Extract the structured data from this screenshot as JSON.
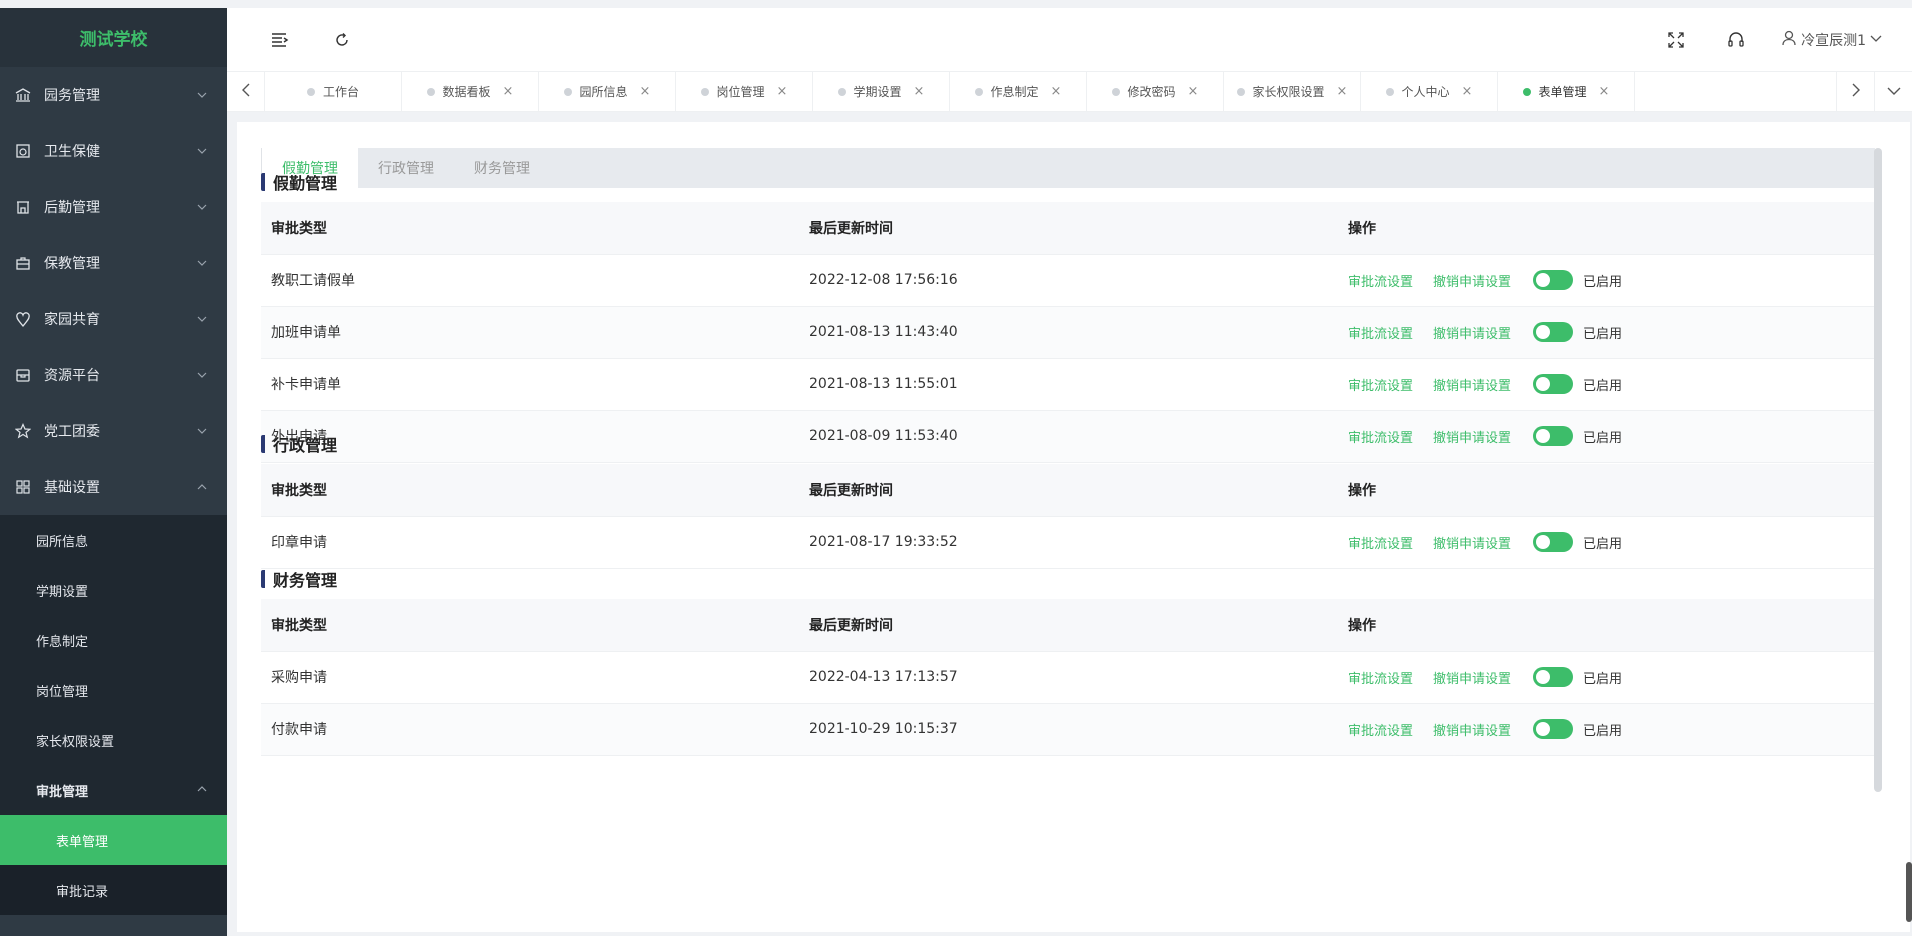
{
  "brand": "测试学校",
  "sidebar": {
    "items": [
      {
        "label": "园务管理"
      },
      {
        "label": "卫生保健"
      },
      {
        "label": "后勤管理"
      },
      {
        "label": "保教管理"
      },
      {
        "label": "家园共育"
      },
      {
        "label": "资源平台"
      },
      {
        "label": "党工团委"
      },
      {
        "label": "基础设置"
      }
    ],
    "sub_items": [
      {
        "label": "园所信息"
      },
      {
        "label": "学期设置"
      },
      {
        "label": "作息制定"
      },
      {
        "label": "岗位管理"
      },
      {
        "label": "家长权限设置"
      },
      {
        "label": "审批管理"
      }
    ],
    "sub_sub_items": [
      {
        "label": "表单管理"
      },
      {
        "label": "审批记录"
      }
    ]
  },
  "header": {
    "user": "冷宣辰测1"
  },
  "tabs": [
    {
      "label": "工作台",
      "closable": false
    },
    {
      "label": "数据看板",
      "closable": true
    },
    {
      "label": "园所信息",
      "closable": true
    },
    {
      "label": "岗位管理",
      "closable": true
    },
    {
      "label": "学期设置",
      "closable": true
    },
    {
      "label": "作息制定",
      "closable": true
    },
    {
      "label": "修改密码",
      "closable": true
    },
    {
      "label": "家长权限设置",
      "closable": true
    },
    {
      "label": "个人中心",
      "closable": true
    },
    {
      "label": "表单管理",
      "closable": true,
      "active": true
    }
  ],
  "close_glyph": "×",
  "subtabs": [
    {
      "label": "假勤管理"
    },
    {
      "label": "行政管理"
    },
    {
      "label": "财务管理"
    }
  ],
  "table_headers": {
    "type": "审批类型",
    "time": "最后更新时间",
    "op": "操作"
  },
  "op_labels": {
    "flow": "审批流设置",
    "cancel": "撤销申请设置",
    "enabled": "已启用"
  },
  "sections": [
    {
      "title": "假勤管理",
      "rows": [
        {
          "type": "教职工请假单",
          "time": "2022-12-08 17:56:16"
        },
        {
          "type": "加班申请单",
          "time": "2021-08-13 11:43:40"
        },
        {
          "type": "补卡申请单",
          "time": "2021-08-13 11:55:01"
        },
        {
          "type": "外出申请",
          "time": "2021-08-09 11:53:40"
        }
      ]
    },
    {
      "title": "行政管理",
      "rows": [
        {
          "type": "印章申请",
          "time": "2021-08-17 19:33:52"
        }
      ]
    },
    {
      "title": "财务管理",
      "rows": [
        {
          "type": "采购申请",
          "time": "2022-04-13 17:13:57"
        },
        {
          "type": "付款申请",
          "time": "2021-10-29 10:15:37"
        }
      ]
    }
  ],
  "colors": {
    "accent": "#3dbd6a",
    "sidebar": "#2f3a44",
    "section_bar": "#2b3a73"
  }
}
